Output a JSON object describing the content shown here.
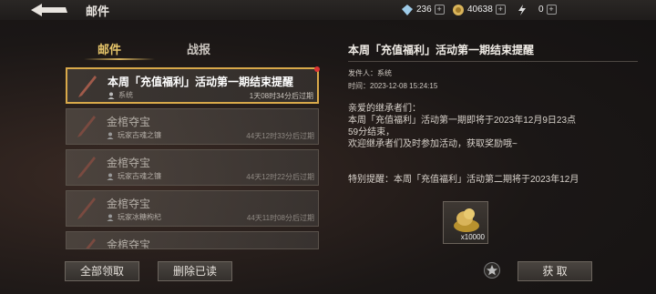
{
  "header": {
    "title": "邮件",
    "resources": [
      {
        "icon": "diamond-icon",
        "value": "236"
      },
      {
        "icon": "coin-icon",
        "value": "40638"
      },
      {
        "icon": "lightning-icon",
        "value": "0"
      }
    ],
    "plus": "+"
  },
  "tabs": [
    {
      "label": "邮件",
      "active": true
    },
    {
      "label": "战报",
      "active": false
    }
  ],
  "mails": [
    {
      "subject": "本周「充值福利」活动第一期结束提醒",
      "sender": "系统",
      "expires": "1天08时34分后过期",
      "selected": true,
      "unread": true
    },
    {
      "subject": "金棺夺宝",
      "sender": "玩家古魂之镰",
      "expires": "44天12时33分后过期",
      "selected": false
    },
    {
      "subject": "金棺夺宝",
      "sender": "玩家古魂之镰",
      "expires": "44天12时22分后过期",
      "selected": false
    },
    {
      "subject": "金棺夺宝",
      "sender": "玩家冰糖枸杞",
      "expires": "44天11时08分后过期",
      "selected": false
    },
    {
      "subject": "金棺夺宝",
      "sender": "",
      "expires": "",
      "selected": false
    }
  ],
  "buttons": {
    "claim_all": "全部领取",
    "delete_read": "删除已读",
    "claim": "获 取"
  },
  "detail": {
    "title": "本周「充值福利」活动第一期结束提醒",
    "sender_label": "发件人：系统",
    "time_label": "时间：2023-12-08 15:24:15",
    "body": [
      "亲爱的继承者们：",
      "本周「充值福利」活动第一期即将于2023年12月9日23点",
      "59分结束，",
      "欢迎继承者们及时参加活动，获取奖励哦~"
    ],
    "note": "特别提醒：本周「充值福利」活动第二期将于2023年12月",
    "reward_qty": "x10000"
  }
}
